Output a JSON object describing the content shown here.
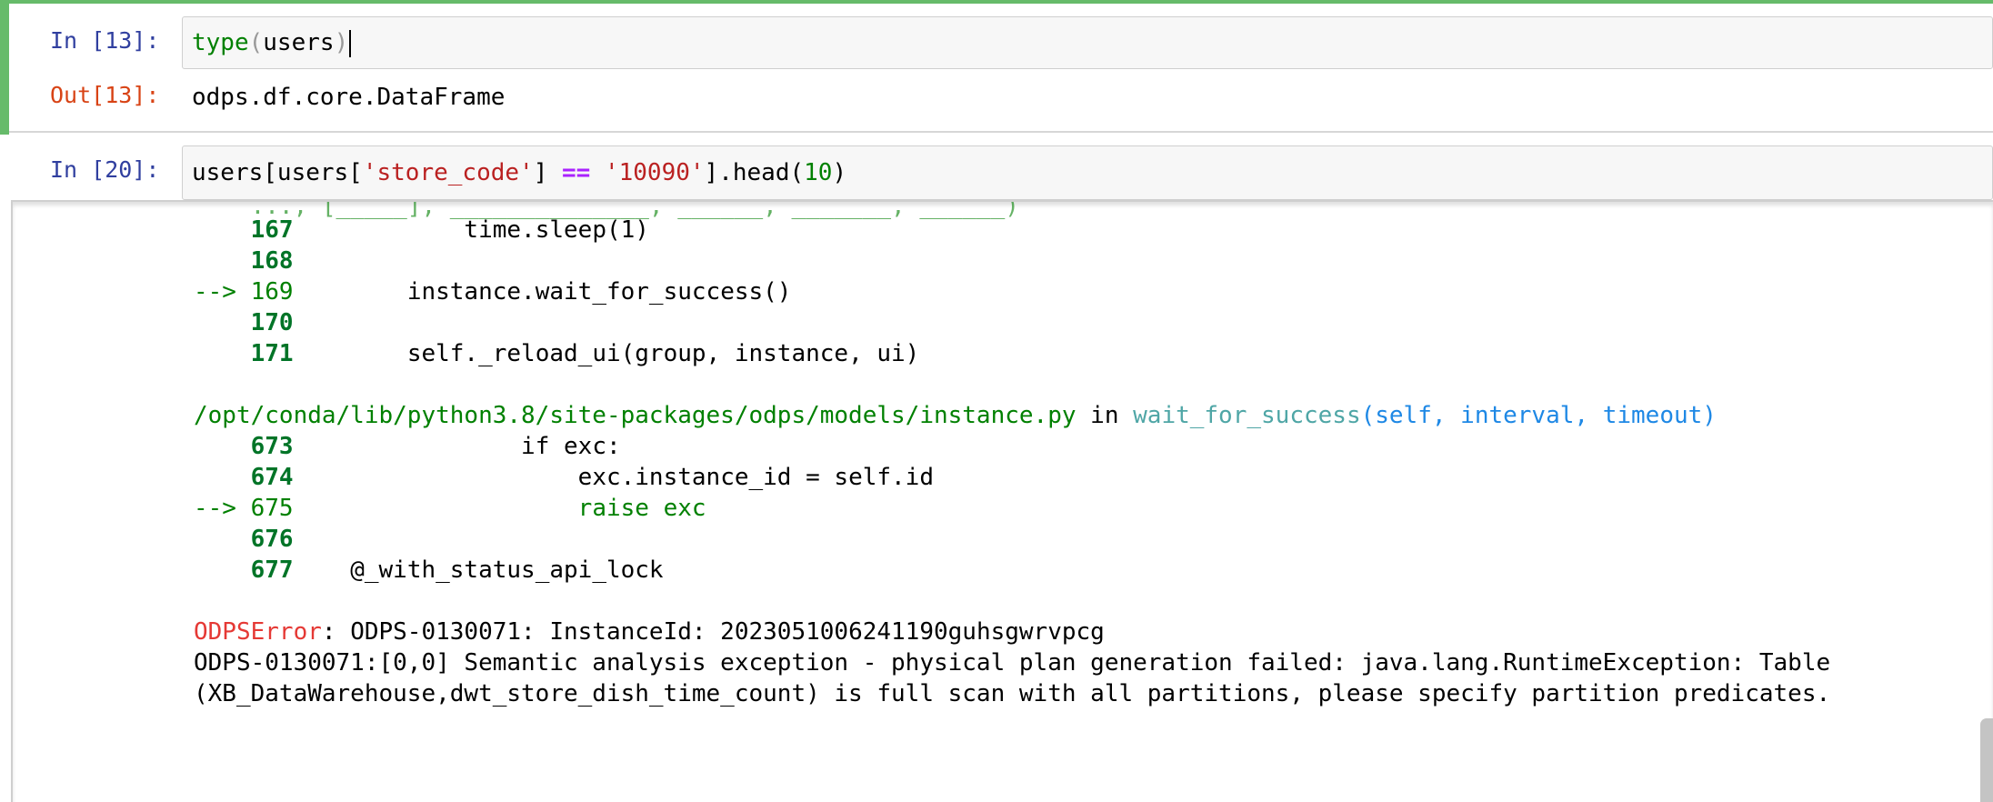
{
  "cells": [
    {
      "input_prompt": "In [13]:",
      "code_tokens": [
        "type",
        "(",
        "users",
        ")"
      ],
      "output_prompt": "Out[13]:",
      "output_text": "odps.df.core.DataFrame"
    },
    {
      "input_prompt": "In [20]:",
      "code_tokens": [
        "users[users[",
        "'store_code'",
        "] ",
        "==",
        " ",
        "'10090'",
        "].head(",
        "10",
        ")"
      ]
    }
  ],
  "traceback": {
    "clipped_top_line": "    ..., [_____], ______________, ______, _______, ______)",
    "frame1": {
      "lines": [
        {
          "no": "167",
          "arrow": false,
          "code": "            time.sleep(1)"
        },
        {
          "no": "168",
          "arrow": false,
          "code": ""
        },
        {
          "no": "169",
          "arrow": true,
          "code": "        instance.wait_for_success()"
        },
        {
          "no": "170",
          "arrow": false,
          "code": ""
        },
        {
          "no": "171",
          "arrow": false,
          "code": "        self._reload_ui(group, instance, ui)"
        }
      ]
    },
    "frame2": {
      "file": "/opt/conda/lib/python3.8/site-packages/odps/models/instance.py",
      "in_word": " in ",
      "func": "wait_for_success",
      "args": "(self, interval, timeout)",
      "lines": [
        {
          "no": "673",
          "arrow": false,
          "code": "                if exc:"
        },
        {
          "no": "674",
          "arrow": false,
          "code": "                    exc.instance_id = self.id"
        },
        {
          "no": "675",
          "arrow": true,
          "code": "                    raise exc"
        },
        {
          "no": "676",
          "arrow": false,
          "code": ""
        },
        {
          "no": "677",
          "arrow": false,
          "code": "    @_with_status_api_lock"
        }
      ]
    },
    "arrow_label": "-->",
    "error_name": "ODPSError",
    "error_line1": ": ODPS-0130071: InstanceId: 2023051006241190guhsgwrvpcg",
    "error_line2": "ODPS-0130071:[0,0] Semantic analysis exception - physical plan generation failed: java.lang.RuntimeException: Table",
    "error_line3": "(XB_DataWarehouse,dwt_store_dish_time_count) is full scan with all partitions, please specify partition predicates."
  },
  "colors": {
    "selected_cell_border": "#66bb6a",
    "in_prompt": "#303f9f",
    "out_prompt": "#d84315"
  }
}
